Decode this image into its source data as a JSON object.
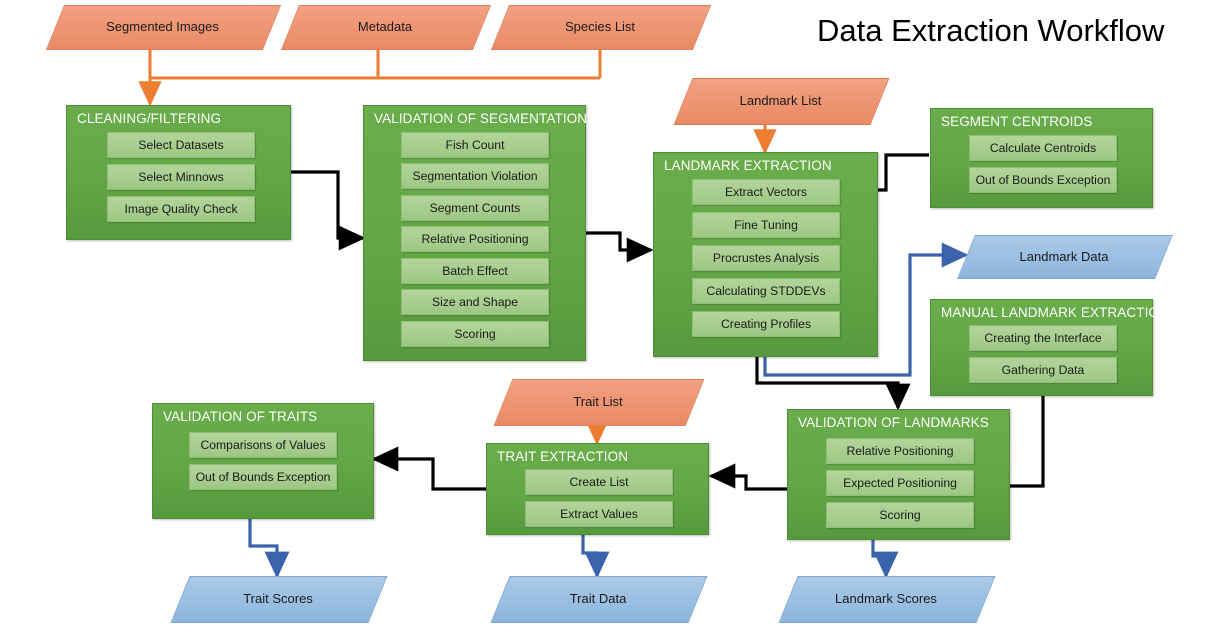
{
  "page": {
    "title": "Data Extraction Workflow",
    "background": "#ffffff"
  },
  "colors": {
    "group_fill": "#63a646",
    "group_border": "#4f8c37",
    "item_fill": "#a9cf90",
    "item_border": "#8fbd76",
    "input_fill": "#ee9573",
    "input_border": "#e07e57",
    "output_fill": "#9cc0e3",
    "output_border": "#7fa8d2",
    "arrow_black": "#000000",
    "arrow_orange": "#ed7d31",
    "arrow_blue": "#3a63ab",
    "group_title_text": "#ffffff",
    "item_text": "#1a1a1a"
  },
  "inputs": [
    {
      "id": "segmented-images",
      "label": "Segmented Images"
    },
    {
      "id": "metadata",
      "label": "Metadata"
    },
    {
      "id": "species-list",
      "label": "Species  List"
    },
    {
      "id": "landmark-list",
      "label": "Landmark List"
    },
    {
      "id": "trait-list",
      "label": "Trait List"
    }
  ],
  "outputs": [
    {
      "id": "landmark-data",
      "label": "Landmark Data"
    },
    {
      "id": "trait-scores",
      "label": "Trait Scores"
    },
    {
      "id": "trait-data",
      "label": "Trait Data"
    },
    {
      "id": "landmark-scores",
      "label": "Landmark Scores"
    }
  ],
  "groups": [
    {
      "id": "cleaning-filtering",
      "title": "CLEANING/FILTERING",
      "items": [
        "Select Datasets",
        "Select Minnows",
        "Image Quality Check"
      ]
    },
    {
      "id": "validation-of-segmentation",
      "title": "VALIDATION OF SEGMENTATION",
      "items": [
        "Fish Count",
        "Segmentation Violation",
        "Segment Counts",
        "Relative Positioning",
        "Batch Effect",
        "Size and Shape",
        "Scoring"
      ]
    },
    {
      "id": "landmark-extraction",
      "title": "LANDMARK EXTRACTION",
      "items": [
        "Extract Vectors",
        "Fine Tuning",
        "Procrustes Analysis",
        "Calculating STDDEVs",
        "Creating Profiles"
      ]
    },
    {
      "id": "segment-centroids",
      "title": "SEGMENT CENTROIDS",
      "items": [
        "Calculate Centroids",
        "Out of Bounds Exception"
      ]
    },
    {
      "id": "manual-landmark-extraction",
      "title": "MANUAL LANDMARK EXTRACTION",
      "items": [
        "Creating the Interface",
        "Gathering Data"
      ]
    },
    {
      "id": "validation-of-traits",
      "title": "VALIDATION OF TRAITS",
      "items": [
        "Comparisons of Values",
        "Out of Bounds Exception"
      ]
    },
    {
      "id": "trait-extraction",
      "title": "TRAIT EXTRACTION",
      "items": [
        "Create List",
        "Extract Values"
      ]
    },
    {
      "id": "validation-of-landmarks",
      "title": "VALIDATION OF LANDMARKS",
      "items": [
        "Relative Positioning",
        "Expected Positioning",
        "Scoring"
      ]
    }
  ]
}
